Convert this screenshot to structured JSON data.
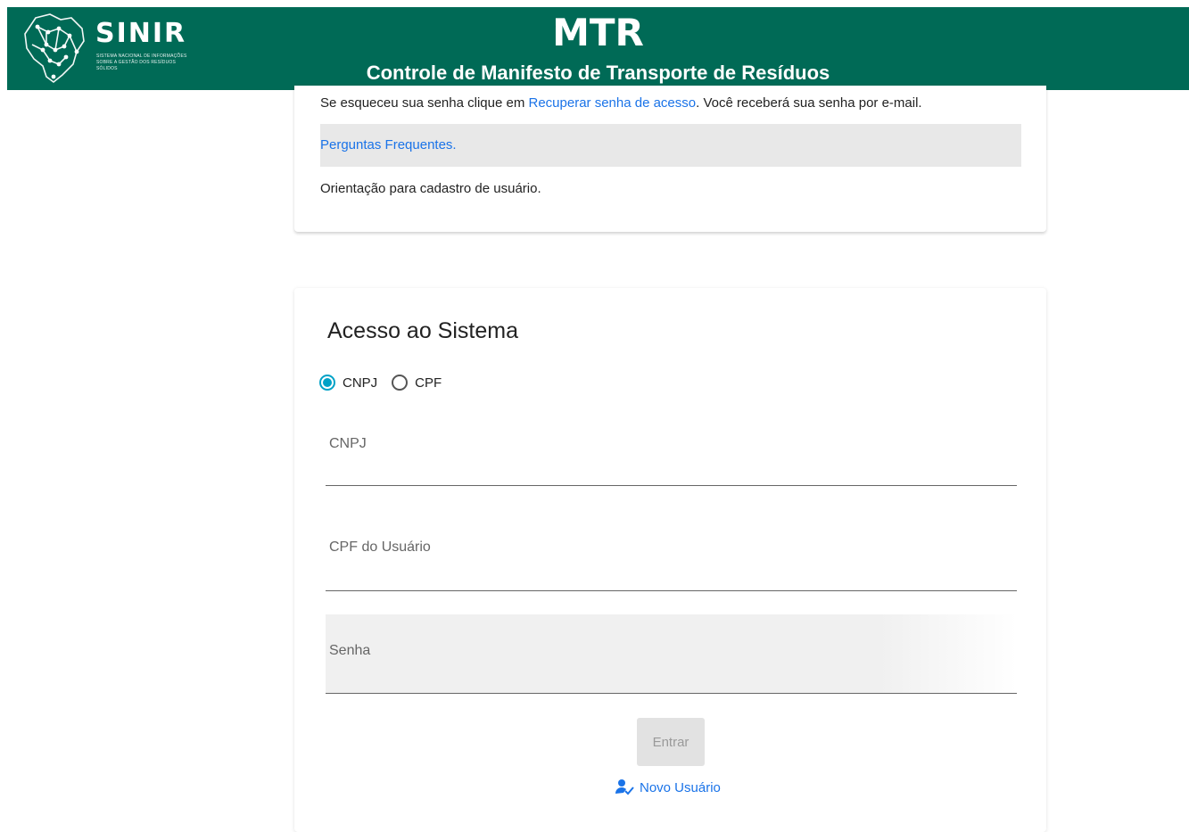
{
  "header": {
    "logo_text": "SINIR",
    "logo_subtitle": "SISTEMA NACIONAL DE INFORMAÇÕES SOBRE A GESTÃO DOS RESÍDUOS SÓLIDOS",
    "title": "MTR",
    "subtitle": "Controle de Manifesto de Transporte de Resíduos",
    "color": "#006a56"
  },
  "info": {
    "recover_prefix": "Se esqueceu sua senha clique em ",
    "recover_link": "Recuperar senha de acesso",
    "recover_suffix": ". Você receberá sua senha por e-mail.",
    "faq_link": "Perguntas Frequentes.",
    "orientation": "Orientação para cadastro de usuário."
  },
  "login": {
    "title": "Acesso ao Sistema",
    "radio_cnpj": "CNPJ",
    "radio_cpf": "CPF",
    "selected": "CNPJ",
    "cnpj_label": "CNPJ",
    "cpf_label": "CPF do Usuário",
    "password_label": "Senha",
    "submit": "Entrar",
    "new_user": "Novo Usuário"
  },
  "colors": {
    "link": "#1a73e8",
    "radio_accent": "#00a2c7"
  }
}
